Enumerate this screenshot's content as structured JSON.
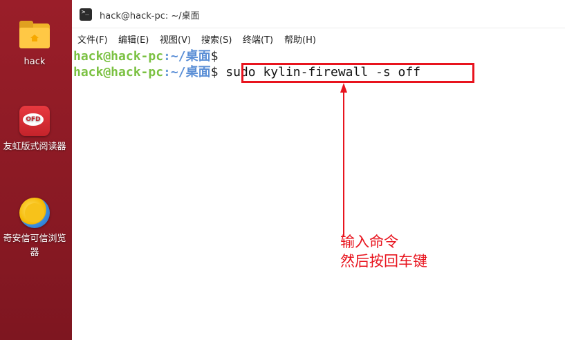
{
  "desktop": {
    "items": [
      {
        "label": "hack",
        "icon": "folder-home-icon"
      },
      {
        "label": "友虹版式阅读器",
        "icon": "ofd-reader-icon",
        "icon_text": "OFD"
      },
      {
        "label": "奇安信可信浏览器",
        "icon": "qianxin-browser-icon"
      }
    ]
  },
  "window": {
    "title": "hack@hack-pc: ~/桌面",
    "terminal_icon_glyph": ">_"
  },
  "menu": {
    "items": [
      "文件(F)",
      "编辑(E)",
      "视图(V)",
      "搜索(S)",
      "终端(T)",
      "帮助(H)"
    ]
  },
  "terminal": {
    "lines": [
      {
        "user": "hack@hack-pc",
        "sep": ":",
        "path": "~/桌面",
        "prompt": "$",
        "command": ""
      },
      {
        "user": "hack@hack-pc",
        "sep": ":",
        "path": "~/桌面",
        "prompt": "$",
        "command": "sudo kylin-firewall -s off"
      }
    ]
  },
  "annotation": {
    "line1": "输入命令",
    "line2": "然后按回车键",
    "color": "#e8141e"
  },
  "colors": {
    "desktop_bg": "#8a1a24",
    "prompt_user": "#7bc142",
    "prompt_path": "#5b8fd6",
    "annotation_red": "#e8141e"
  }
}
